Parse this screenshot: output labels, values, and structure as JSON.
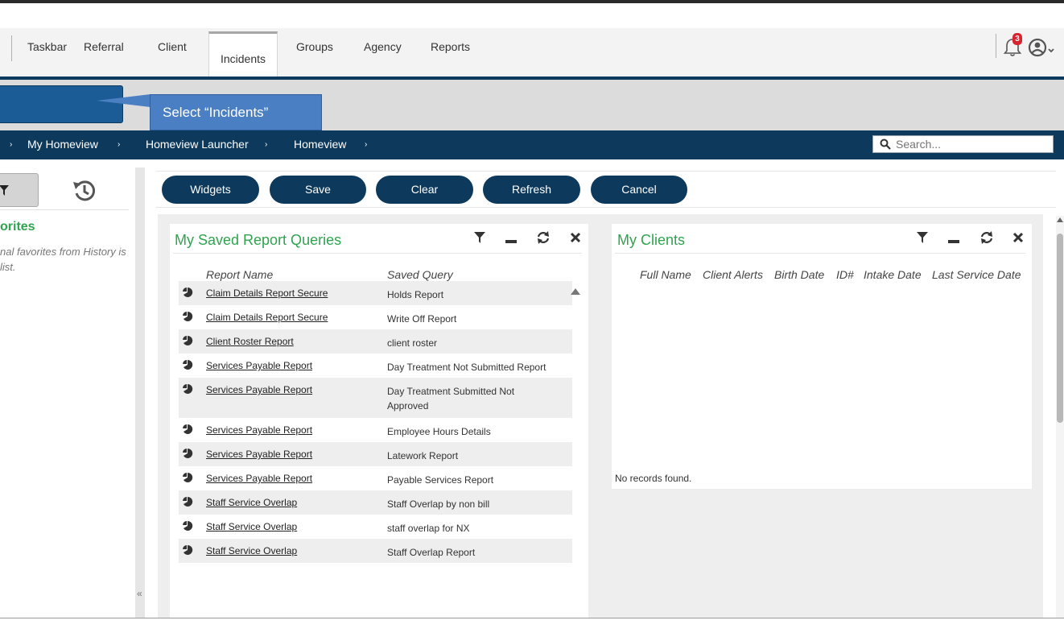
{
  "nav": {
    "tabs": [
      {
        "label": "Taskbar"
      },
      {
        "label": "Referral"
      },
      {
        "label": "Client"
      },
      {
        "label": "Incidents"
      },
      {
        "label": "Groups"
      },
      {
        "label": "Agency"
      },
      {
        "label": "Reports"
      }
    ],
    "active_tab": "Incidents",
    "notification_count": "3"
  },
  "callout": {
    "label": "Select “Incidents”"
  },
  "breadcrumb": {
    "items": [
      "My Homeview",
      "Homeview Launcher",
      "Homeview"
    ],
    "separator": "›"
  },
  "search": {
    "placeholder": "Search..."
  },
  "left_panel": {
    "title": "orites",
    "text": "nal favorites from History is list."
  },
  "toolbar": {
    "buttons": [
      "Widgets",
      "Save",
      "Clear",
      "Refresh",
      "Cancel"
    ]
  },
  "widget_reports": {
    "title": "My Saved Report Queries",
    "columns": [
      "Report Name",
      "Saved Query"
    ],
    "rows": [
      {
        "name": "Claim Details Report Secure",
        "query": "Holds Report"
      },
      {
        "name": "Claim Details Report Secure",
        "query": "Write Off Report"
      },
      {
        "name": "Client Roster Report",
        "query": "client roster"
      },
      {
        "name": "Services Payable Report",
        "query": "Day Treatment Not Submitted Report"
      },
      {
        "name": "Services Payable Report",
        "query": "Day Treatment Submitted Not Approved"
      },
      {
        "name": "Services Payable Report",
        "query": "Employee Hours Details"
      },
      {
        "name": "Services Payable Report",
        "query": "Latework Report"
      },
      {
        "name": "Services Payable Report",
        "query": "Payable Services Report"
      },
      {
        "name": "Staff Service Overlap",
        "query": "Staff Overlap by non bill"
      },
      {
        "name": "Staff Service Overlap",
        "query": "staff overlap for NX"
      },
      {
        "name": "Staff Service Overlap",
        "query": "Staff Overlap Report"
      }
    ]
  },
  "widget_clients": {
    "title": "My Clients",
    "columns": [
      "Full Name",
      "Client Alerts",
      "Birth Date",
      "ID#",
      "Intake Date",
      "Last Service Date"
    ],
    "empty_text": "No records found."
  },
  "colors": {
    "navy": "#0d3a5c",
    "green_title": "#2ea44f",
    "callout_blue": "#4a7fc4",
    "badge_red": "#d9232e"
  }
}
